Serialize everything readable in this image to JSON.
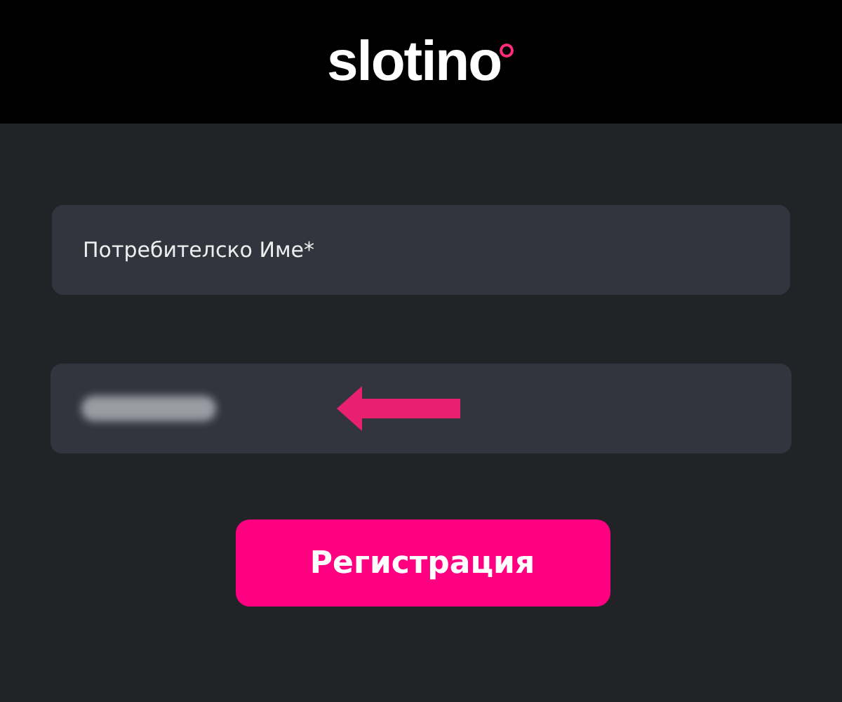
{
  "header": {
    "logo": "slotino"
  },
  "fields": [
    {
      "kind": "text",
      "placeholder": "Потребителско Име*"
    },
    {
      "kind": "blurred"
    }
  ],
  "button": {
    "label": "Регистрация"
  }
}
